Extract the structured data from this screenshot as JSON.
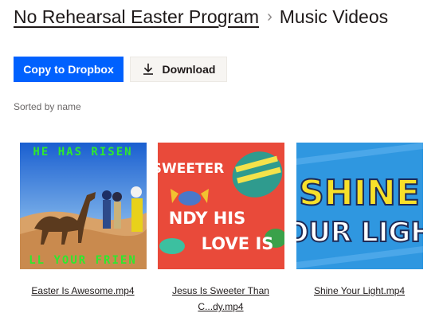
{
  "breadcrumb": {
    "parent": "No Rehearsal Easter Program",
    "separator": "›",
    "current": "Music Videos"
  },
  "actions": {
    "copy_label": "Copy to Dropbox",
    "download_label": "Download",
    "primary_color": "#0061fe"
  },
  "sort_label": "Sorted by name",
  "files": [
    {
      "name": "Easter Is Awesome.mp4",
      "thumb_text_top": "HE HAS RISEN",
      "thumb_text_bottom": "LL YOUR FRIEN"
    },
    {
      "name": "Jesus Is Sweeter Than C...dy.mp4",
      "thumb_text_top": "SWEETER",
      "thumb_text_mid": "NDY  HIS",
      "thumb_text_bottom": "LOVE IS"
    },
    {
      "name": "Shine Your Light.mp4",
      "thumb_text_top": "SHINE",
      "thumb_text_bottom": "YOUR LIGHT"
    }
  ]
}
